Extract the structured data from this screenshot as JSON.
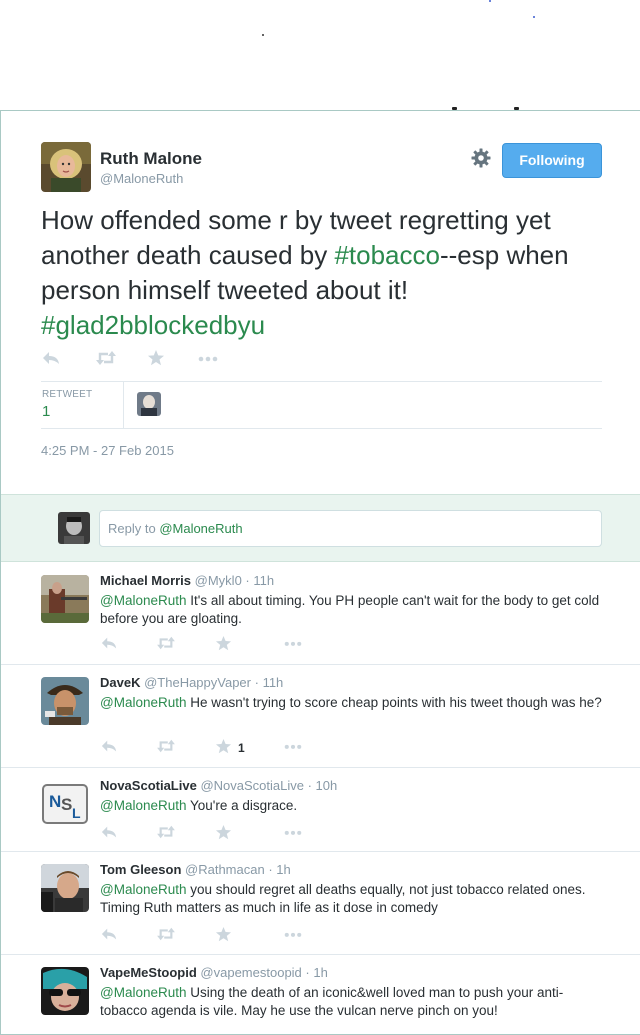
{
  "main_tweet": {
    "author_name": "Ruth Malone",
    "author_handle": "@MaloneRuth",
    "follow_label": "Following",
    "text_parts": [
      {
        "text": "How offended some r by tweet regretting yet another death caused by ",
        "hashtag": false
      },
      {
        "text": "#tobacco",
        "hashtag": true
      },
      {
        "text": "--esp when person himself tweeted about it! ",
        "hashtag": false
      },
      {
        "text": "#glad2bblockedbyu",
        "hashtag": true
      }
    ],
    "retweet_label": "RETWEET",
    "retweet_count": "1",
    "timestamp": "4:25 PM - 27 Feb 2015"
  },
  "reply_box": {
    "prefix": "Reply to ",
    "mention": "@MaloneRuth"
  },
  "replies": [
    {
      "name": "Michael Morris",
      "handle": "@Mykl0",
      "time": "11h",
      "mention": "@MaloneRuth",
      "text": " It's all about timing. You PH people can't wait for the body to get cold before you are gloating.",
      "fav_count": ""
    },
    {
      "name": "DaveK",
      "handle": "@TheHappyVaper",
      "time": "11h",
      "mention": "@MaloneRuth",
      "text": " He wasn't trying to score cheap points with his tweet though was he?",
      "fav_count": "1"
    },
    {
      "name": "NovaScotiaLive",
      "handle": "@NovaScotiaLive",
      "time": "10h",
      "mention": "@MaloneRuth",
      "text": " You're a disgrace.",
      "fav_count": ""
    },
    {
      "name": "Tom Gleeson",
      "handle": "@Rathmacan",
      "time": "1h",
      "mention": "@MaloneRuth",
      "text": " you should regret all deaths equally, not just tobacco related ones. Timing Ruth matters as much in life as it dose in comedy",
      "fav_count": ""
    },
    {
      "name": "VapeMeStoopid",
      "handle": "@vapemestoopid",
      "time": "1h",
      "mention": "@MaloneRuth",
      "text": " Using the death of an iconic&well loved man to push your anti-tobacco agenda is vile. May he use the vulcan nerve pinch on you!",
      "fav_count": ""
    }
  ],
  "icons": [
    "reply-icon",
    "retweet-icon",
    "favorite-icon",
    "more-icon",
    "gear-icon"
  ],
  "colors": {
    "hashtag": "#2b8a4e",
    "follow_button": "#55acee",
    "reply_box_bg": "#e9f4ef",
    "meta": "#8899a6"
  }
}
